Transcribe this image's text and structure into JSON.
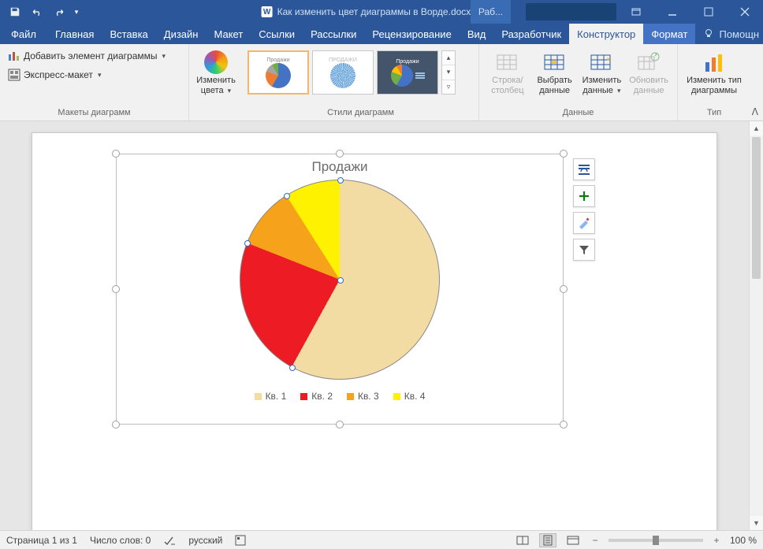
{
  "titlebar": {
    "doc_title": "Как изменить цвет диаграммы в Ворде.docx - Word",
    "contextual_tab_header": "Раб..."
  },
  "menu": {
    "file": "Файл",
    "home": "Главная",
    "insert": "Вставка",
    "design": "Дизайн",
    "layout": "Макет",
    "references": "Ссылки",
    "mailings": "Рассылки",
    "review": "Рецензирование",
    "view": "Вид",
    "developer": "Разработчик",
    "chart_design": "Конструктор",
    "chart_format": "Формат",
    "tell_me": "Помощн"
  },
  "ribbon": {
    "layouts": {
      "add_element": "Добавить элемент диаграммы",
      "quick_layout": "Экспресс-макет",
      "group": "Макеты диаграмм"
    },
    "colors": {
      "change_colors_l1": "Изменить",
      "change_colors_l2": "цвета"
    },
    "styles_group": "Стили диаграмм",
    "data": {
      "switch_l1": "Строка/",
      "switch_l2": "столбец",
      "select_l1": "Выбрать",
      "select_l2": "данные",
      "edit_l1": "Изменить",
      "edit_l2": "данные",
      "refresh_l1": "Обновить",
      "refresh_l2": "данные",
      "group": "Данные"
    },
    "type": {
      "change_l1": "Изменить тип",
      "change_l2": "диаграммы",
      "group": "Тип"
    }
  },
  "chart_data": {
    "type": "pie",
    "title": "Продажи",
    "categories": [
      "Кв. 1",
      "Кв. 2",
      "Кв. 3",
      "Кв. 4"
    ],
    "values": [
      58,
      23,
      10,
      9
    ],
    "colors": [
      "#f3dca4",
      "#ed1c24",
      "#f6a21b",
      "#fff200"
    ]
  },
  "chart_tools": {
    "layout": "layout-options",
    "plus": "chart-elements",
    "brush": "chart-styles",
    "filter": "chart-filters"
  },
  "status": {
    "page": "Страница 1 из 1",
    "words": "Число слов: 0",
    "lang": "русский",
    "zoom": "100 %"
  }
}
